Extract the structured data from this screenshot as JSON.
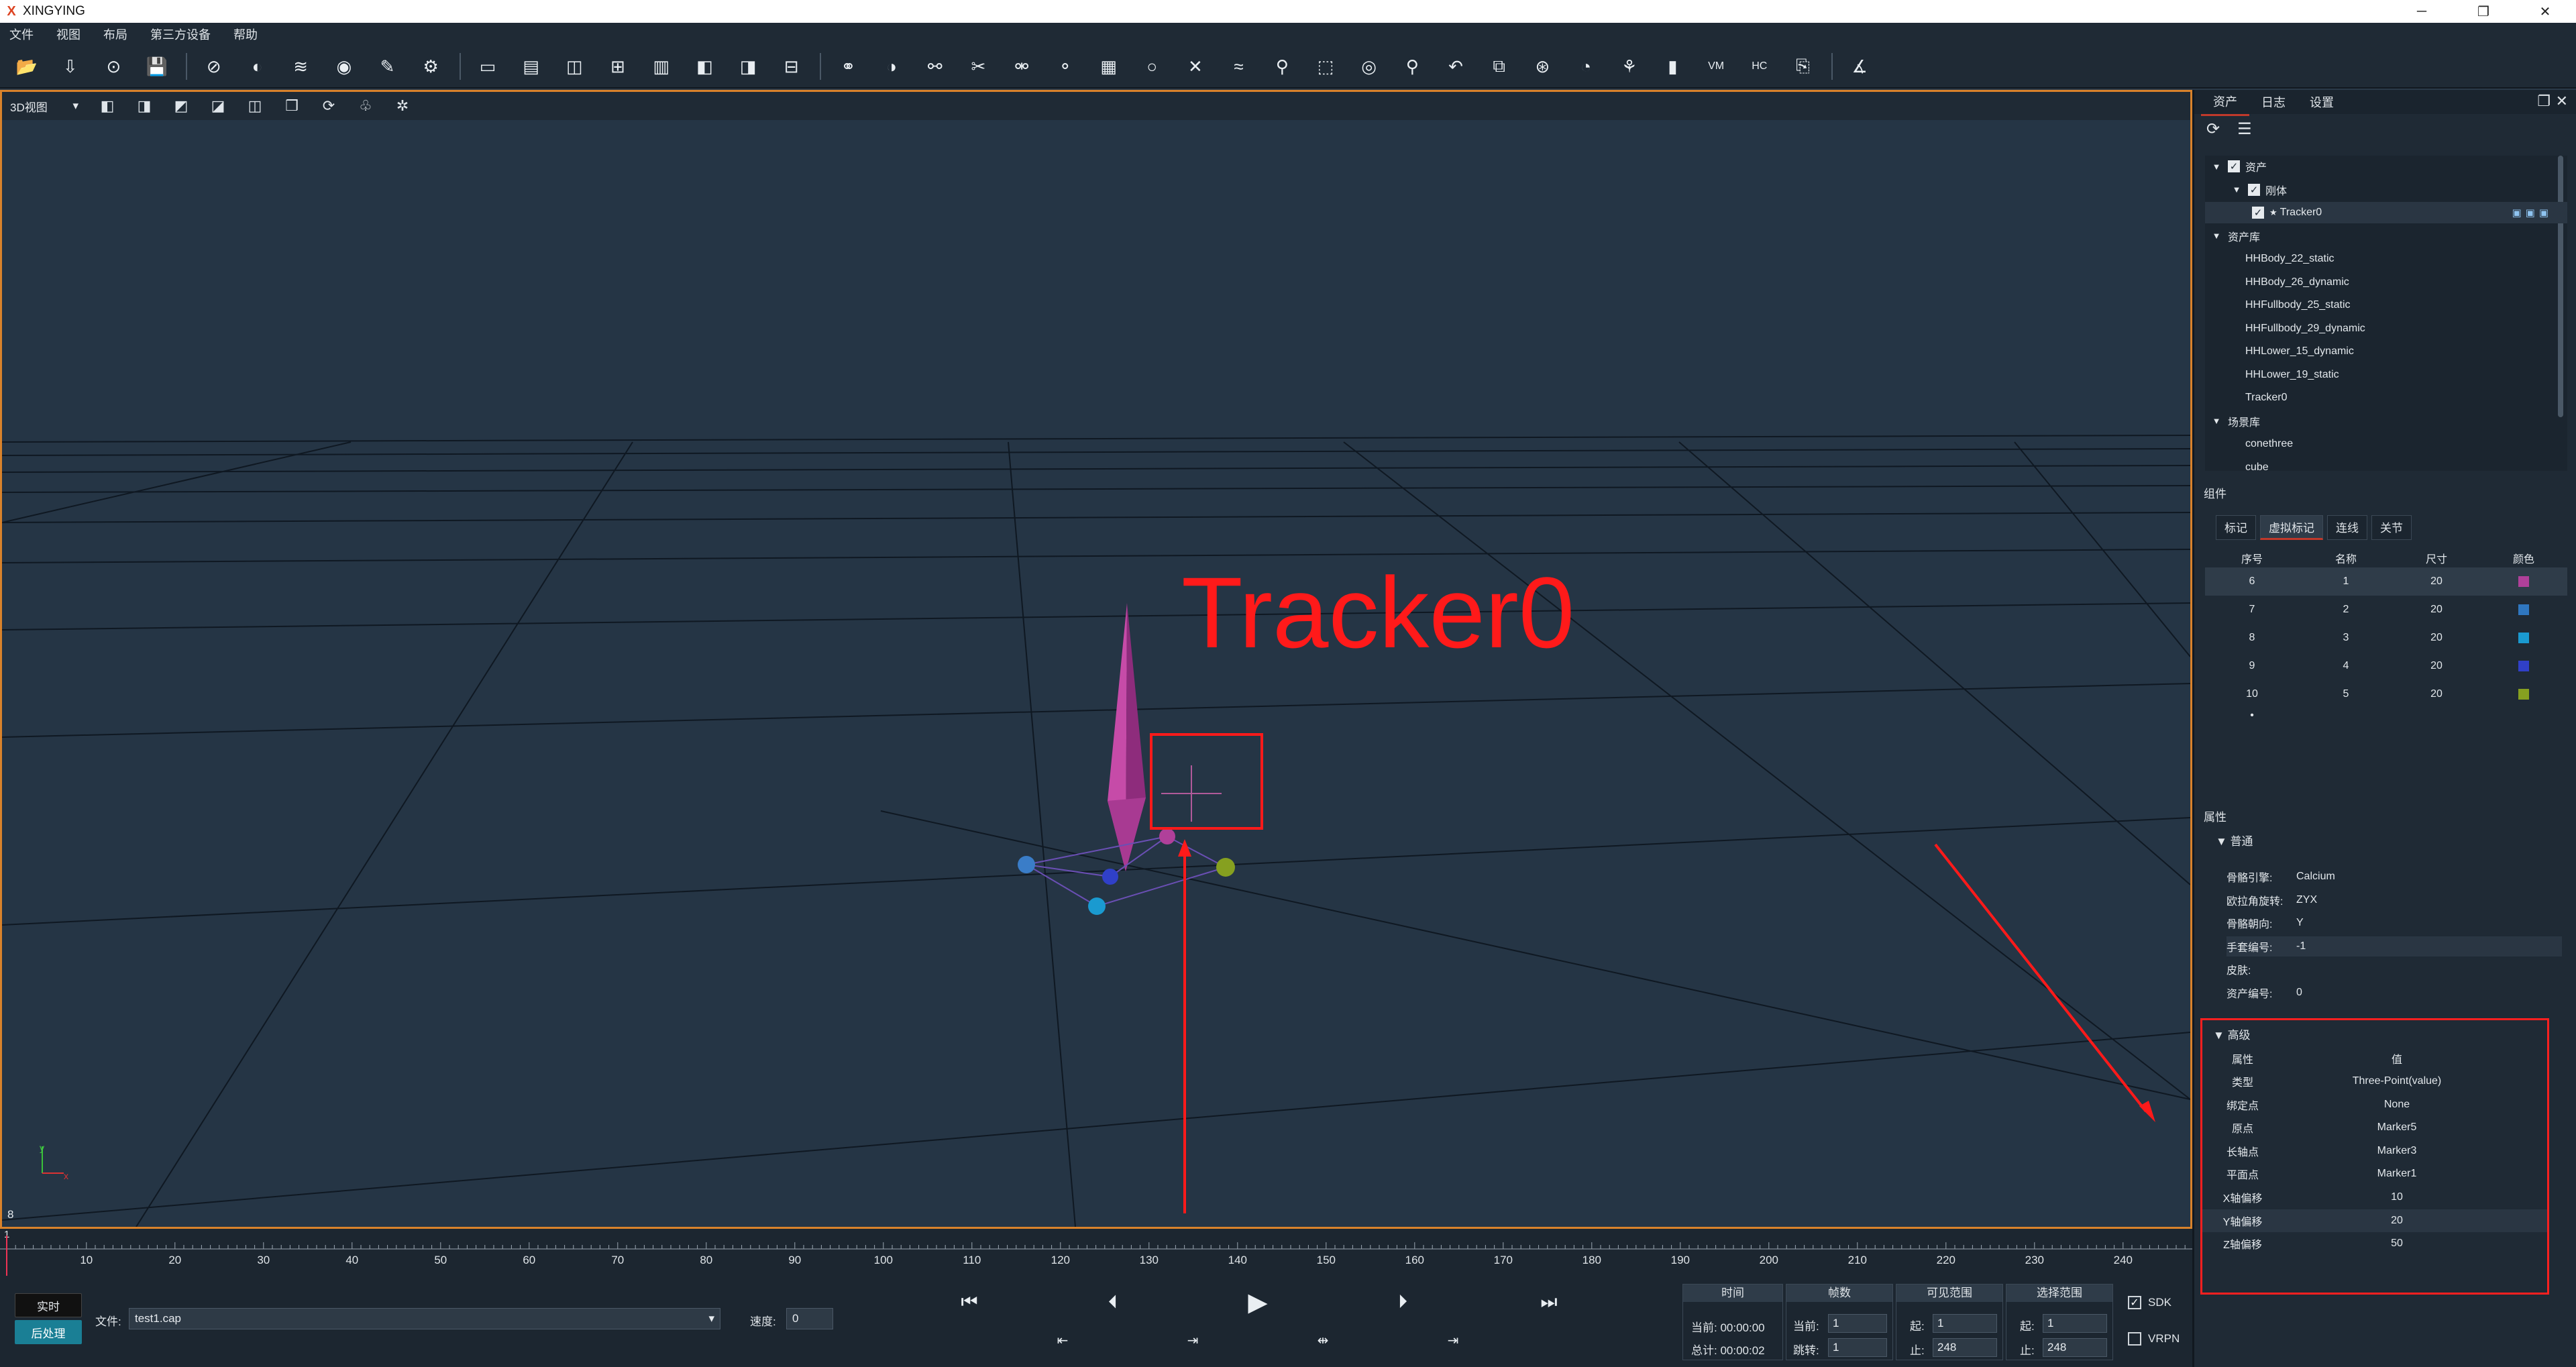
{
  "app": {
    "title": "XINGYING",
    "logo": "X"
  },
  "window_controls": [
    "─",
    "❐",
    "✕"
  ],
  "menu": [
    "文件",
    "视图",
    "布局",
    "第三方设备",
    "帮助"
  ],
  "toolbar_icons": [
    "open-folder-icon",
    "import-icon",
    "camera-save-icon",
    "save-icon",
    "visibility-toggle-icon",
    "mirror-icon",
    "layers-icon",
    "eye-settings-icon",
    "edit-icon",
    "settings-gear-icon",
    "single-view-icon",
    "split-horizontal-icon",
    "split-vertical-icon",
    "grid-view-icon",
    "top-split-icon",
    "left-split-icon",
    "right-split-icon",
    "quad-view-icon",
    "link-markers-icon",
    "overlap-icon",
    "link-icon",
    "cut-icon",
    "connect-icon",
    "disconnect-icon",
    "calculator-icon",
    "sphere-icon",
    "remove-marker-icon",
    "wave-icon",
    "filter-icon",
    "select-box-icon",
    "target-icon",
    "skeleton-icon",
    "undo-icon",
    "screenshot-icon",
    "record-icon",
    "speed-icon",
    "graph-icon",
    "bar-chart-icon",
    "vm-icon",
    "hc-icon",
    "export-icon",
    "angle-icon"
  ],
  "viewport": {
    "view_select": "3D视图",
    "tracker_label": "Tracker0",
    "marker_count": "8",
    "axis_x": "x",
    "axis_y": "y"
  },
  "timeline": {
    "start": "1",
    "ticks": [
      "10",
      "20",
      "30",
      "40",
      "50",
      "60",
      "70",
      "80",
      "90",
      "100",
      "110",
      "120",
      "130",
      "140",
      "150",
      "160",
      "170",
      "180",
      "190",
      "200",
      "210",
      "220",
      "230",
      "240"
    ]
  },
  "bottom": {
    "realtime_label": "实时",
    "post_label": "后处理",
    "file_label": "文件:",
    "file_value": "test1.cap",
    "speed_label": "速度:",
    "speed_value": "0",
    "time_head": "时间",
    "time_current": "当前: 00:00:00",
    "time_total": "总计: 00:00:02",
    "frames_head": "帧数",
    "frames_current_label": "当前:",
    "frames_current": "1",
    "frames_jump_label": "跳转:",
    "frames_jump": "1",
    "visible_head": "可见范围",
    "visible_start_label": "起:",
    "visible_start": "1",
    "visible_end_label": "止:",
    "visible_end": "248",
    "select_head": "选择范围",
    "select_start_label": "起:",
    "select_start": "1",
    "select_end_label": "止:",
    "select_end": "248",
    "sdk_label": "SDK",
    "vrpn_label": "VRPN"
  },
  "right_panel": {
    "tabs": [
      "资产",
      "日志",
      "设置"
    ],
    "tree": {
      "assets": "资产",
      "rigid": "刚体",
      "tracker": "Tracker0",
      "asset_lib": "资产库",
      "lib_items": [
        "HHBody_22_static",
        "HHBody_26_dynamic",
        "HHFullbody_25_static",
        "HHFullbody_29_dynamic",
        "HHLower_15_dynamic",
        "HHLower_19_static",
        "Tracker0"
      ],
      "scene_lib": "场景库",
      "scene_items": [
        "conethree",
        "cube"
      ]
    },
    "components_title": "组件",
    "component_tabs": [
      "标记",
      "虚拟标记",
      "连线",
      "关节"
    ],
    "component_headers": [
      "序号",
      "名称",
      "尺寸",
      "颜色"
    ],
    "component_rows": [
      {
        "idx": "6",
        "name": "1",
        "size": "20",
        "color": "#b0409a"
      },
      {
        "idx": "7",
        "name": "2",
        "size": "20",
        "color": "#2f77c0"
      },
      {
        "idx": "8",
        "name": "3",
        "size": "20",
        "color": "#1a9ad0"
      },
      {
        "idx": "9",
        "name": "4",
        "size": "20",
        "color": "#3040c8"
      },
      {
        "idx": "10",
        "name": "5",
        "size": "20",
        "color": "#86a020"
      }
    ],
    "component_more": "•",
    "props_title": "属性",
    "general_title": "普通",
    "general": [
      {
        "k": "骨骼引擎:",
        "v": "Calcium"
      },
      {
        "k": "欧拉角旋转:",
        "v": "ZYX"
      },
      {
        "k": "骨骼朝向:",
        "v": "Y"
      },
      {
        "k": "手套编号:",
        "v": "-1"
      },
      {
        "k": "皮肤:",
        "v": ""
      },
      {
        "k": "资产编号:",
        "v": "0"
      }
    ],
    "advanced_title": "高级",
    "advanced_headers": [
      "属性",
      "值"
    ],
    "advanced": [
      {
        "k": "类型",
        "v": "Three-Point(value)"
      },
      {
        "k": "绑定点",
        "v": "None"
      },
      {
        "k": "原点",
        "v": "Marker5"
      },
      {
        "k": "长轴点",
        "v": "Marker3"
      },
      {
        "k": "平面点",
        "v": "Marker1"
      },
      {
        "k": "X轴偏移",
        "v": "10"
      },
      {
        "k": "Y轴偏移",
        "v": "20"
      },
      {
        "k": "Z轴偏移",
        "v": "50"
      }
    ]
  },
  "colors": {
    "accent": "#d9822b",
    "annotation": "#ff1a1a",
    "viewport_bg": "#253545"
  }
}
